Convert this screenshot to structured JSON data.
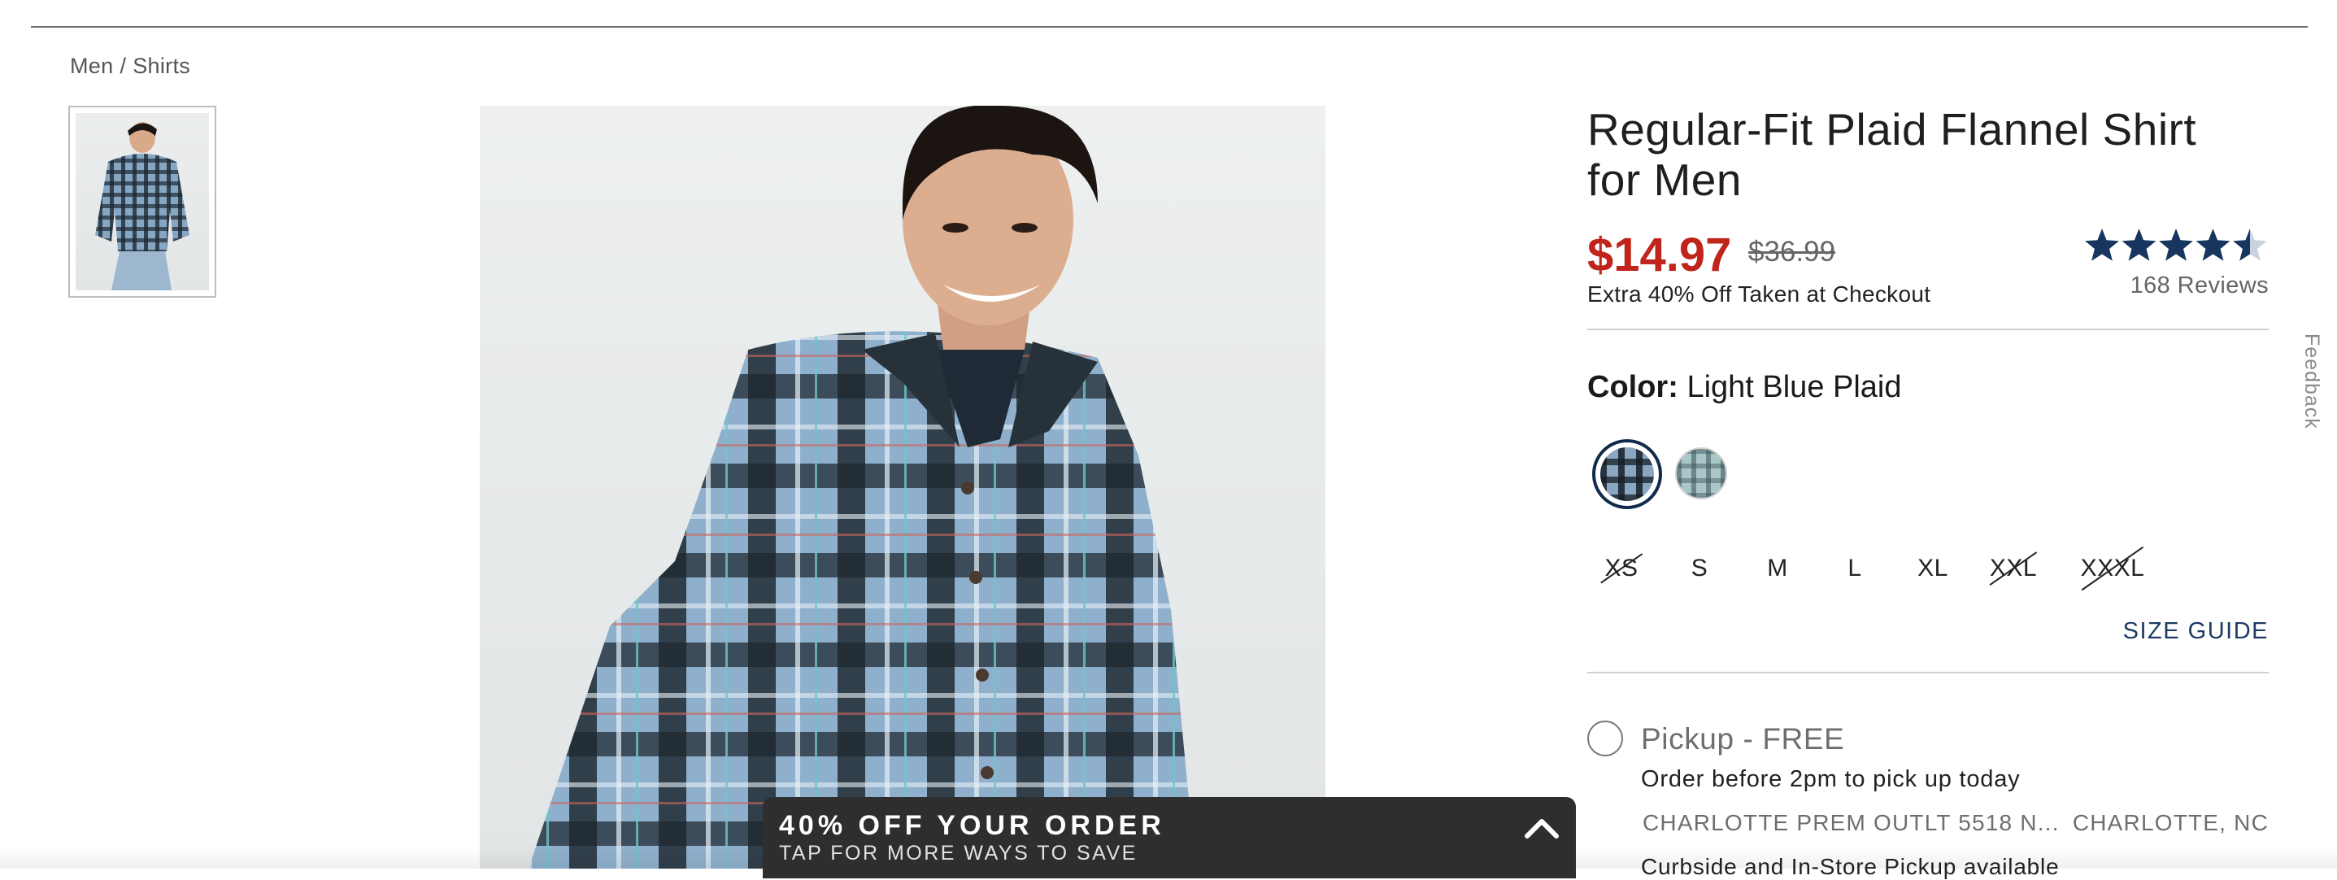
{
  "breadcrumb": {
    "parent": "Men",
    "separator": "/",
    "current": "Shirts"
  },
  "product": {
    "title": "Regular-Fit Plaid Flannel Shirt for Men",
    "price": "$14.97",
    "original_price": "$36.99",
    "promo_note": "Extra 40% Off Taken at Checkout",
    "rating_value": 4.5,
    "rating_max": 5,
    "reviews_label": "168 Reviews",
    "color_label": "Color:",
    "color_value": "Light Blue Plaid",
    "swatches": [
      {
        "name": "Light Blue Plaid",
        "selected": true
      },
      {
        "name": "Teal Plaid",
        "selected": false
      }
    ],
    "sizes": [
      {
        "label": "XS",
        "available": false
      },
      {
        "label": "S",
        "available": true
      },
      {
        "label": "M",
        "available": true
      },
      {
        "label": "L",
        "available": true
      },
      {
        "label": "XL",
        "available": true
      },
      {
        "label": "XXL",
        "available": false
      },
      {
        "label": "XXXL",
        "available": false
      }
    ],
    "size_guide_label": "SIZE GUIDE"
  },
  "fulfillment": {
    "pickup_label": "Pickup - FREE",
    "order_before": "Order before 2pm to pick up today",
    "store_name": "CHARLOTTE PREM OUTLT 5518 N...",
    "store_city": "CHARLOTTE, NC",
    "curbside": "Curbside and In-Store Pickup available"
  },
  "feedback_label": "Feedback",
  "promo_bar": {
    "title": "40% OFF YOUR ORDER",
    "subtitle": "TAP FOR MORE WAYS TO SAVE"
  },
  "colors": {
    "sale_price": "#c0241b",
    "star": "#17365f",
    "link": "#1b3a66",
    "promo_bg": "#2e2e2e"
  },
  "icons": {
    "rating": "star-icon",
    "promo_toggle": "chevron-up-icon"
  }
}
